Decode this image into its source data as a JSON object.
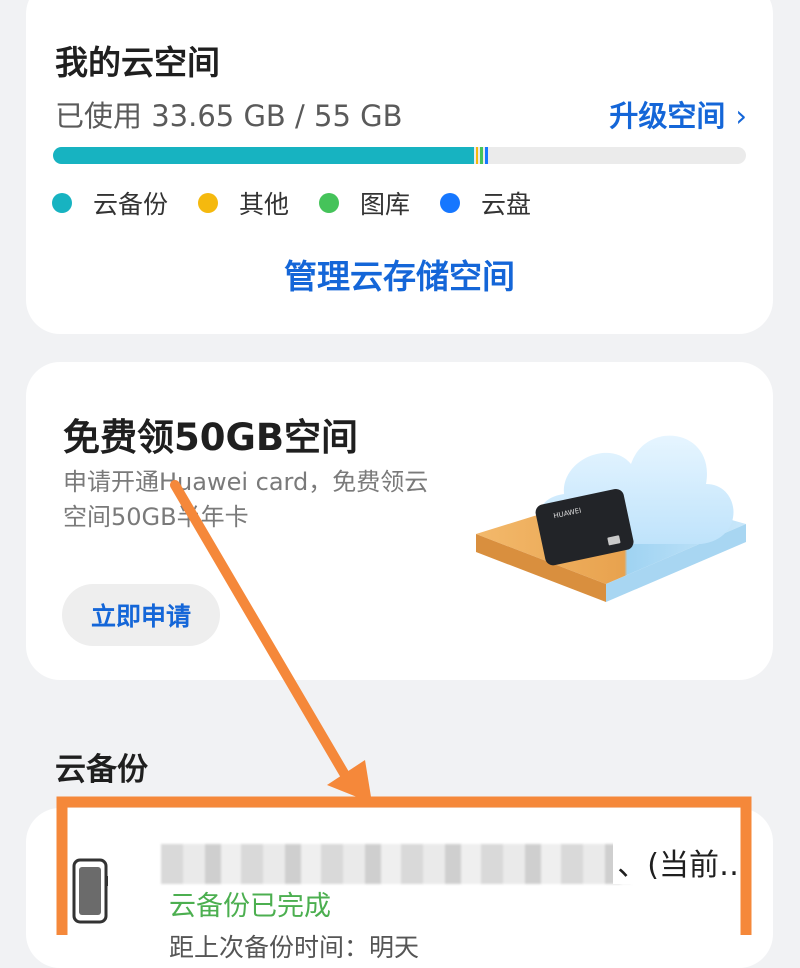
{
  "storage": {
    "title": "我的云空间",
    "usage_text": "已使用 33.65 GB / 55 GB",
    "upgrade_label": "升级空间",
    "used_gb": 33.65,
    "total_gb": 55,
    "segments": [
      {
        "name": "云备份",
        "fraction": 0.607,
        "color": "#17b3c1"
      },
      {
        "name": "其他",
        "fraction": 0.004,
        "color": "#f5b90e"
      },
      {
        "name": "图库",
        "fraction": 0.004,
        "color": "#45c35a"
      },
      {
        "name": "云盘",
        "fraction": 0.004,
        "color": "#1677ff"
      }
    ],
    "legend": [
      {
        "label": "云备份",
        "color": "#17b3c1"
      },
      {
        "label": "其他",
        "color": "#f5b90e"
      },
      {
        "label": "图库",
        "color": "#45c35a"
      },
      {
        "label": "云盘",
        "color": "#1677ff"
      }
    ],
    "manage_label": "管理云存储空间",
    "track_color": "#ebebeb"
  },
  "promo": {
    "title": "免费领50GB空间",
    "description": "申请开通Huawei card，免费领云空间50GB半年卡",
    "button_label": "立即申请",
    "card_brand": "HUAWEI"
  },
  "backup": {
    "section_title": "云备份",
    "device_suffix": "、(当前…",
    "status": "云备份已完成",
    "last_backup_prefix": "距上次备份时间：明天"
  },
  "colors": {
    "accent": "#1466d8",
    "success": "#4caf50",
    "annotation": "#f5883a"
  }
}
